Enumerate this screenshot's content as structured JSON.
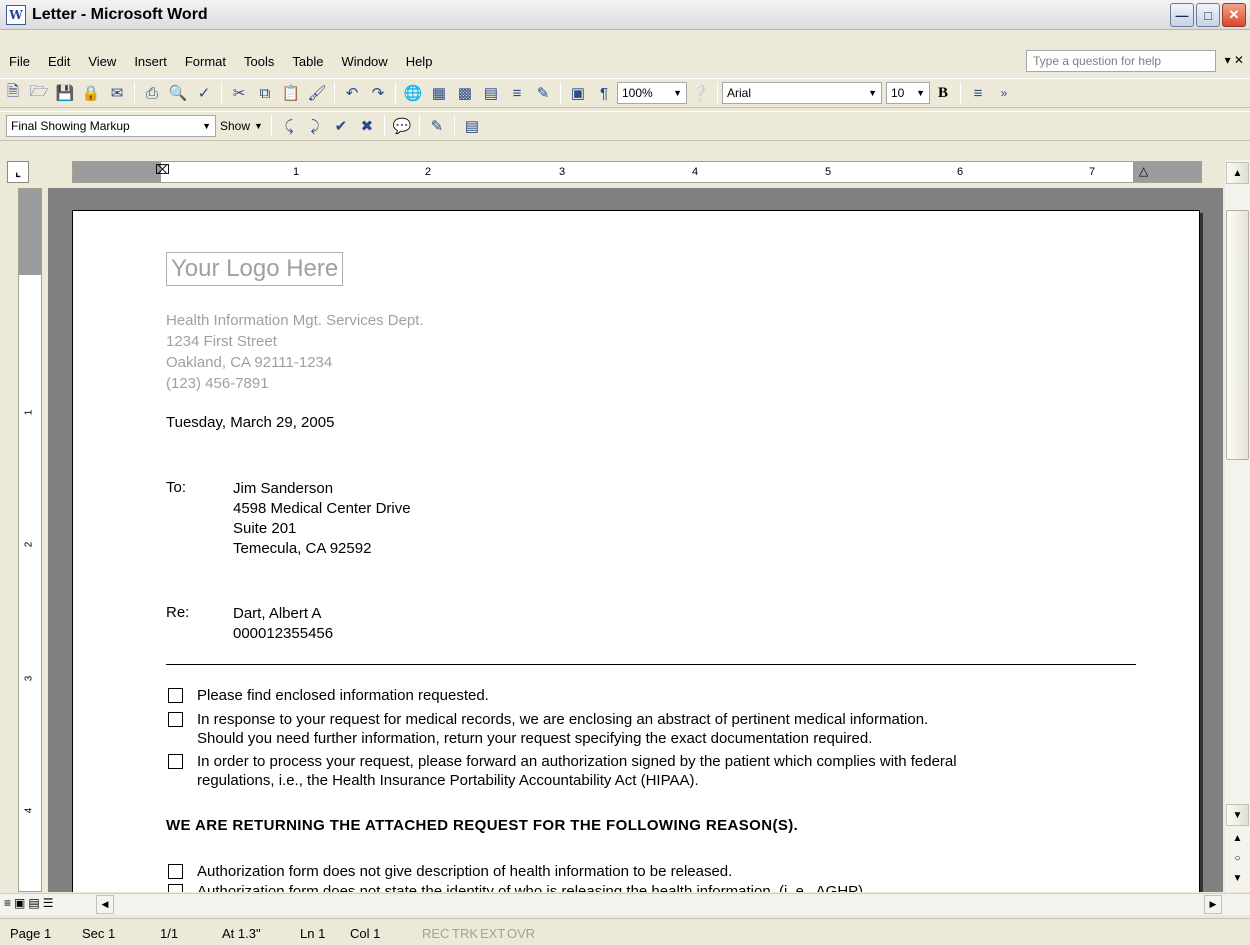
{
  "window": {
    "title": "Letter - Microsoft Word",
    "icon": "W"
  },
  "menu": {
    "items": [
      "File",
      "Edit",
      "View",
      "Insert",
      "Format",
      "Tools",
      "Table",
      "Window",
      "Help"
    ],
    "help_placeholder": "Type a question for help"
  },
  "toolbar": {
    "zoom": "100%",
    "font": "Arial",
    "size": "10",
    "bold": "B",
    "markup": "Final Showing Markup",
    "show": "Show"
  },
  "ruler": {
    "numbers": [
      "1",
      "2",
      "3",
      "4",
      "5",
      "6",
      "7"
    ]
  },
  "vruler": {
    "numbers": [
      "1",
      "2",
      "3",
      "4"
    ]
  },
  "letter": {
    "logo": "Your Logo Here",
    "sender": [
      "Health Information Mgt. Services Dept.",
      "1234 First Street",
      "Oakland, CA 92111-1234",
      "(123) 456-7891"
    ],
    "date": "Tuesday, March 29, 2005",
    "to_label": "To:",
    "to_lines": [
      "Jim Sanderson",
      "4598 Medical Center Drive",
      "Suite 201",
      "Temecula, CA 92592"
    ],
    "re_label": "Re:",
    "re_lines": [
      "Dart, Albert A",
      "000012355456"
    ],
    "checks": [
      [
        "Please find enclosed information requested."
      ],
      [
        "In response to your request for medical records, we are enclosing an abstract of pertinent medical information.",
        "Should you need further information, return your request specifying the exact documentation required."
      ],
      [
        "In order to process your request, please forward an authorization signed by the patient which complies with federal",
        "regulations, i.e., the Health Insurance Portability Accountability Act (HIPAA)."
      ]
    ],
    "heading": "WE ARE RETURNING THE ATTACHED REQUEST FOR THE FOLLOWING REASON(S).",
    "reasons": [
      "Authorization form does not give description of health information to be released.",
      "Authorization form does not state the identity of who is releasing the health information. (i. e., AGHP)"
    ]
  },
  "status": {
    "page": "Page 1",
    "sec": "Sec 1",
    "pages": "1/1",
    "at": "At 1.3\"",
    "ln": "Ln 1",
    "col": "Col 1",
    "rec": "REC",
    "trk": "TRK",
    "ext": "EXT",
    "ovr": "OVR"
  }
}
